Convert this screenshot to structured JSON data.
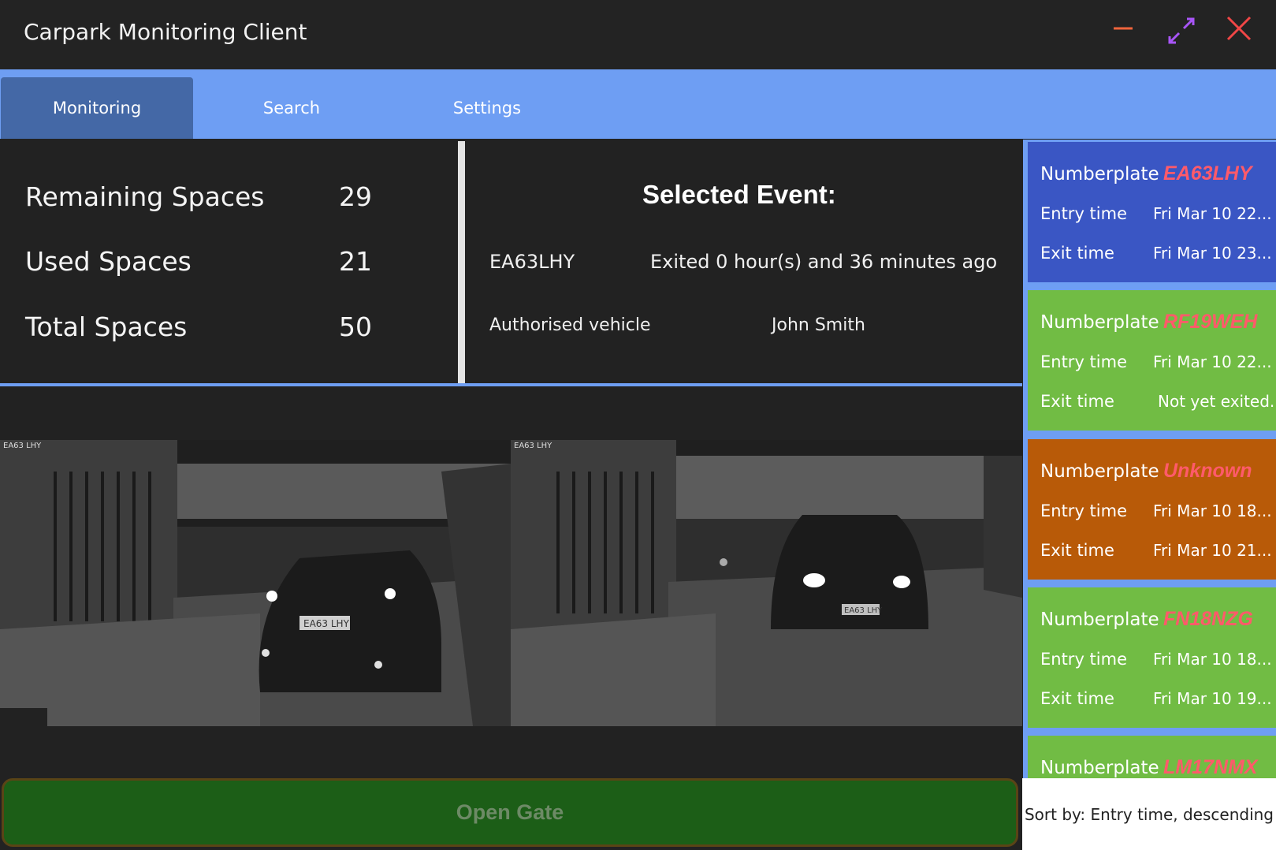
{
  "app": {
    "title": "Carpark Monitoring Client"
  },
  "window_controls": {
    "minimize_icon": "minimize-icon",
    "maximize_icon": "maximize-icon",
    "close_icon": "close-icon",
    "minimize_color": "#f0643c",
    "maximize_color": "#a855f7",
    "close_color": "#f04646"
  },
  "tabs": [
    {
      "label": "Monitoring",
      "active": true
    },
    {
      "label": "Search",
      "active": false
    },
    {
      "label": "Settings",
      "active": false
    }
  ],
  "stats": [
    {
      "label": "Remaining Spaces",
      "value": "29"
    },
    {
      "label": "Used Spaces",
      "value": "21"
    },
    {
      "label": "Total Spaces",
      "value": "50"
    }
  ],
  "selected_event": {
    "title": "Selected Event:",
    "plate": "EA63LHY",
    "status": "Exited 0 hour(s) and 36 minutes ago",
    "auth_label": "Authorised vehicle",
    "owner": "John Smith"
  },
  "cameras": [
    {
      "label": "EA63 LHY",
      "plate_text": "EA63 LHY"
    },
    {
      "label": "EA63 LHY",
      "plate_text": "EA63 LHY"
    }
  ],
  "open_gate": {
    "label": "Open Gate"
  },
  "events": [
    {
      "np_label": "Numberplate",
      "plate": "EA63LHY",
      "entry_label": "Entry time",
      "entry": "Fri Mar 10 22...",
      "exit_label": "Exit time",
      "exit": "Fri Mar 10 23...",
      "color": "#3a56c4"
    },
    {
      "np_label": "Numberplate",
      "plate": "RF19WEH",
      "entry_label": "Entry time",
      "entry": "Fri Mar 10 22...",
      "exit_label": "Exit time",
      "exit": "Not yet exited.",
      "color": "#71bc44"
    },
    {
      "np_label": "Numberplate",
      "plate": "Unknown",
      "entry_label": "Entry time",
      "entry": "Fri Mar 10 18...",
      "exit_label": "Exit time",
      "exit": "Fri Mar 10 21...",
      "color": "#b85a08"
    },
    {
      "np_label": "Numberplate",
      "plate": "FN18NZG",
      "entry_label": "Entry time",
      "entry": "Fri Mar 10 18...",
      "exit_label": "Exit time",
      "exit": "Fri Mar 10 19...",
      "color": "#71bc44"
    },
    {
      "np_label": "Numberplate",
      "plate": "LM17NMX",
      "color": "#71bc44"
    }
  ],
  "sort": {
    "label": "Sort by: Entry time, descending"
  }
}
